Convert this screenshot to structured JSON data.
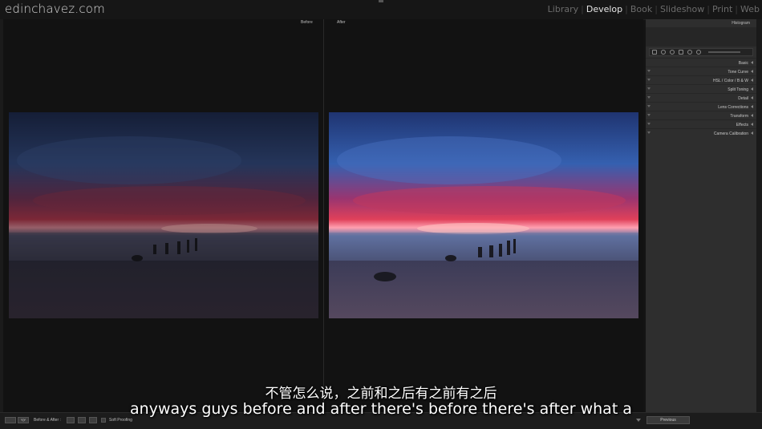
{
  "app": {
    "logo": "edinchavez.com"
  },
  "modules": [
    {
      "label": "Library",
      "active": false
    },
    {
      "label": "Develop",
      "active": true
    },
    {
      "label": "Book",
      "active": false
    },
    {
      "label": "Slideshow",
      "active": false
    },
    {
      "label": "Print",
      "active": false
    },
    {
      "label": "Web",
      "active": false
    }
  ],
  "viewer": {
    "before_label": "Before",
    "after_label": "After"
  },
  "right_panel": {
    "histogram": "Histogram",
    "sections": [
      "Basic",
      "Tone Curve",
      "HSL / Color / B & W",
      "Split Toning",
      "Detail",
      "Lens Corrections",
      "Transform",
      "Effects",
      "Camera Calibration"
    ]
  },
  "toolbar": {
    "yy_label": "Y|Y",
    "before_after_label": "Before & After :",
    "soft_proofing": "Soft Proofing",
    "previous_button": "Previous"
  },
  "subtitles": {
    "chinese": "不管怎么说，之前和之后有之前有之后",
    "english": "anyways guys before and after there's before there's after what a"
  },
  "colors": {
    "sky_blue": "#2d4a8a",
    "sunset_red": "#c2304a",
    "panel_bg": "#2e2e2e"
  }
}
